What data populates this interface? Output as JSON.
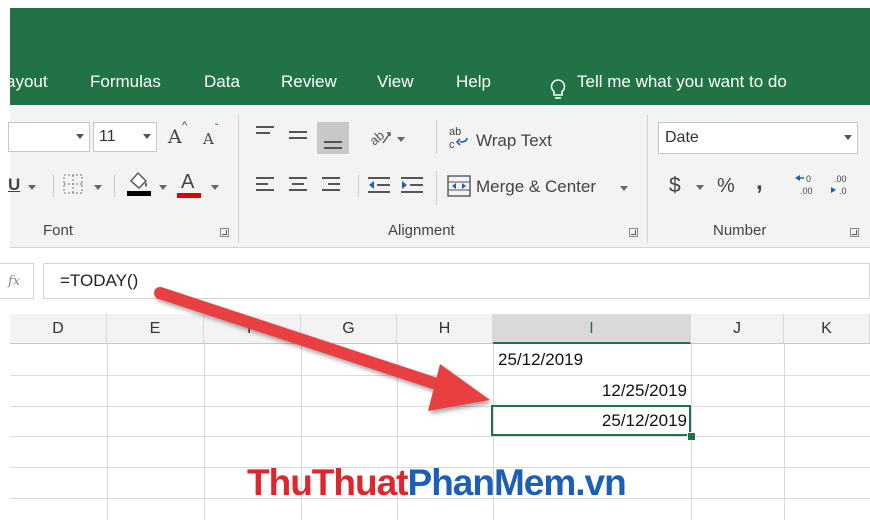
{
  "tabs": [
    {
      "label": "ayout"
    },
    {
      "label": "Formulas"
    },
    {
      "label": "Data"
    },
    {
      "label": "Review"
    },
    {
      "label": "View"
    },
    {
      "label": "Help"
    }
  ],
  "tell_me": "Tell me what you want to do",
  "font_group": {
    "label": "Font",
    "font_size": "11",
    "grow_label": "A",
    "shrink_label": "A",
    "underline_label": "U",
    "font_color_label": "A"
  },
  "alignment_group": {
    "label": "Alignment",
    "wrap_text": "Wrap Text",
    "merge_center": "Merge & Center"
  },
  "number_group": {
    "label": "Number",
    "format_value": "Date",
    "currency": "$",
    "percent": "%",
    "comma": ",",
    "increase_decimal": "←0\n.00",
    "decrease_decimal": ".00\n→.0"
  },
  "formula_bar": {
    "formula": "=TODAY()"
  },
  "columns": [
    "D",
    "E",
    "F",
    "G",
    "H",
    "I",
    "J",
    "K"
  ],
  "selected_column": "I",
  "cells": {
    "row1_I": "25/12/2019",
    "row2_I": "12/25/2019",
    "row3_I": "25/12/2019"
  },
  "watermark": {
    "part1": "ThuThuat",
    "part2": "PhanMem.vn"
  },
  "colors": {
    "excel_green": "#217346",
    "arrow_red": "#e8413f",
    "watermark_red": "#e0262d",
    "watermark_blue": "#1c5fb6"
  }
}
